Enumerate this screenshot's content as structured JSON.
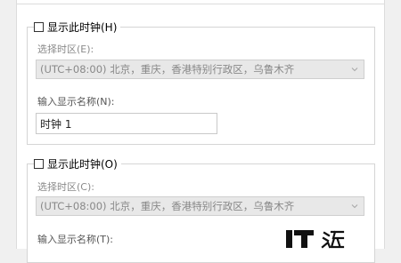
{
  "clock1": {
    "checkbox_label": "显示此时钟(H)",
    "timezone_label": "选择时区(E):",
    "timezone_value": "(UTC+08:00) 北京，重庆，香港特别行政区，乌鲁木齐",
    "name_label": "输入显示名称(N):",
    "name_value": "时钟 1"
  },
  "clock2": {
    "checkbox_label": "显示此时钟(O)",
    "timezone_label": "选择时区(C):",
    "timezone_value": "(UTC+08:00) 北京，重庆，香港特别行政区，乌鲁木齐",
    "name_label": "输入显示名称(T):"
  },
  "icons": {
    "chevron": "chevron-down-icon",
    "watermark": "it-watermark-logo"
  },
  "colors": {
    "disabled_field": "#e8e8e8",
    "group_border": "#d5d5d5"
  }
}
